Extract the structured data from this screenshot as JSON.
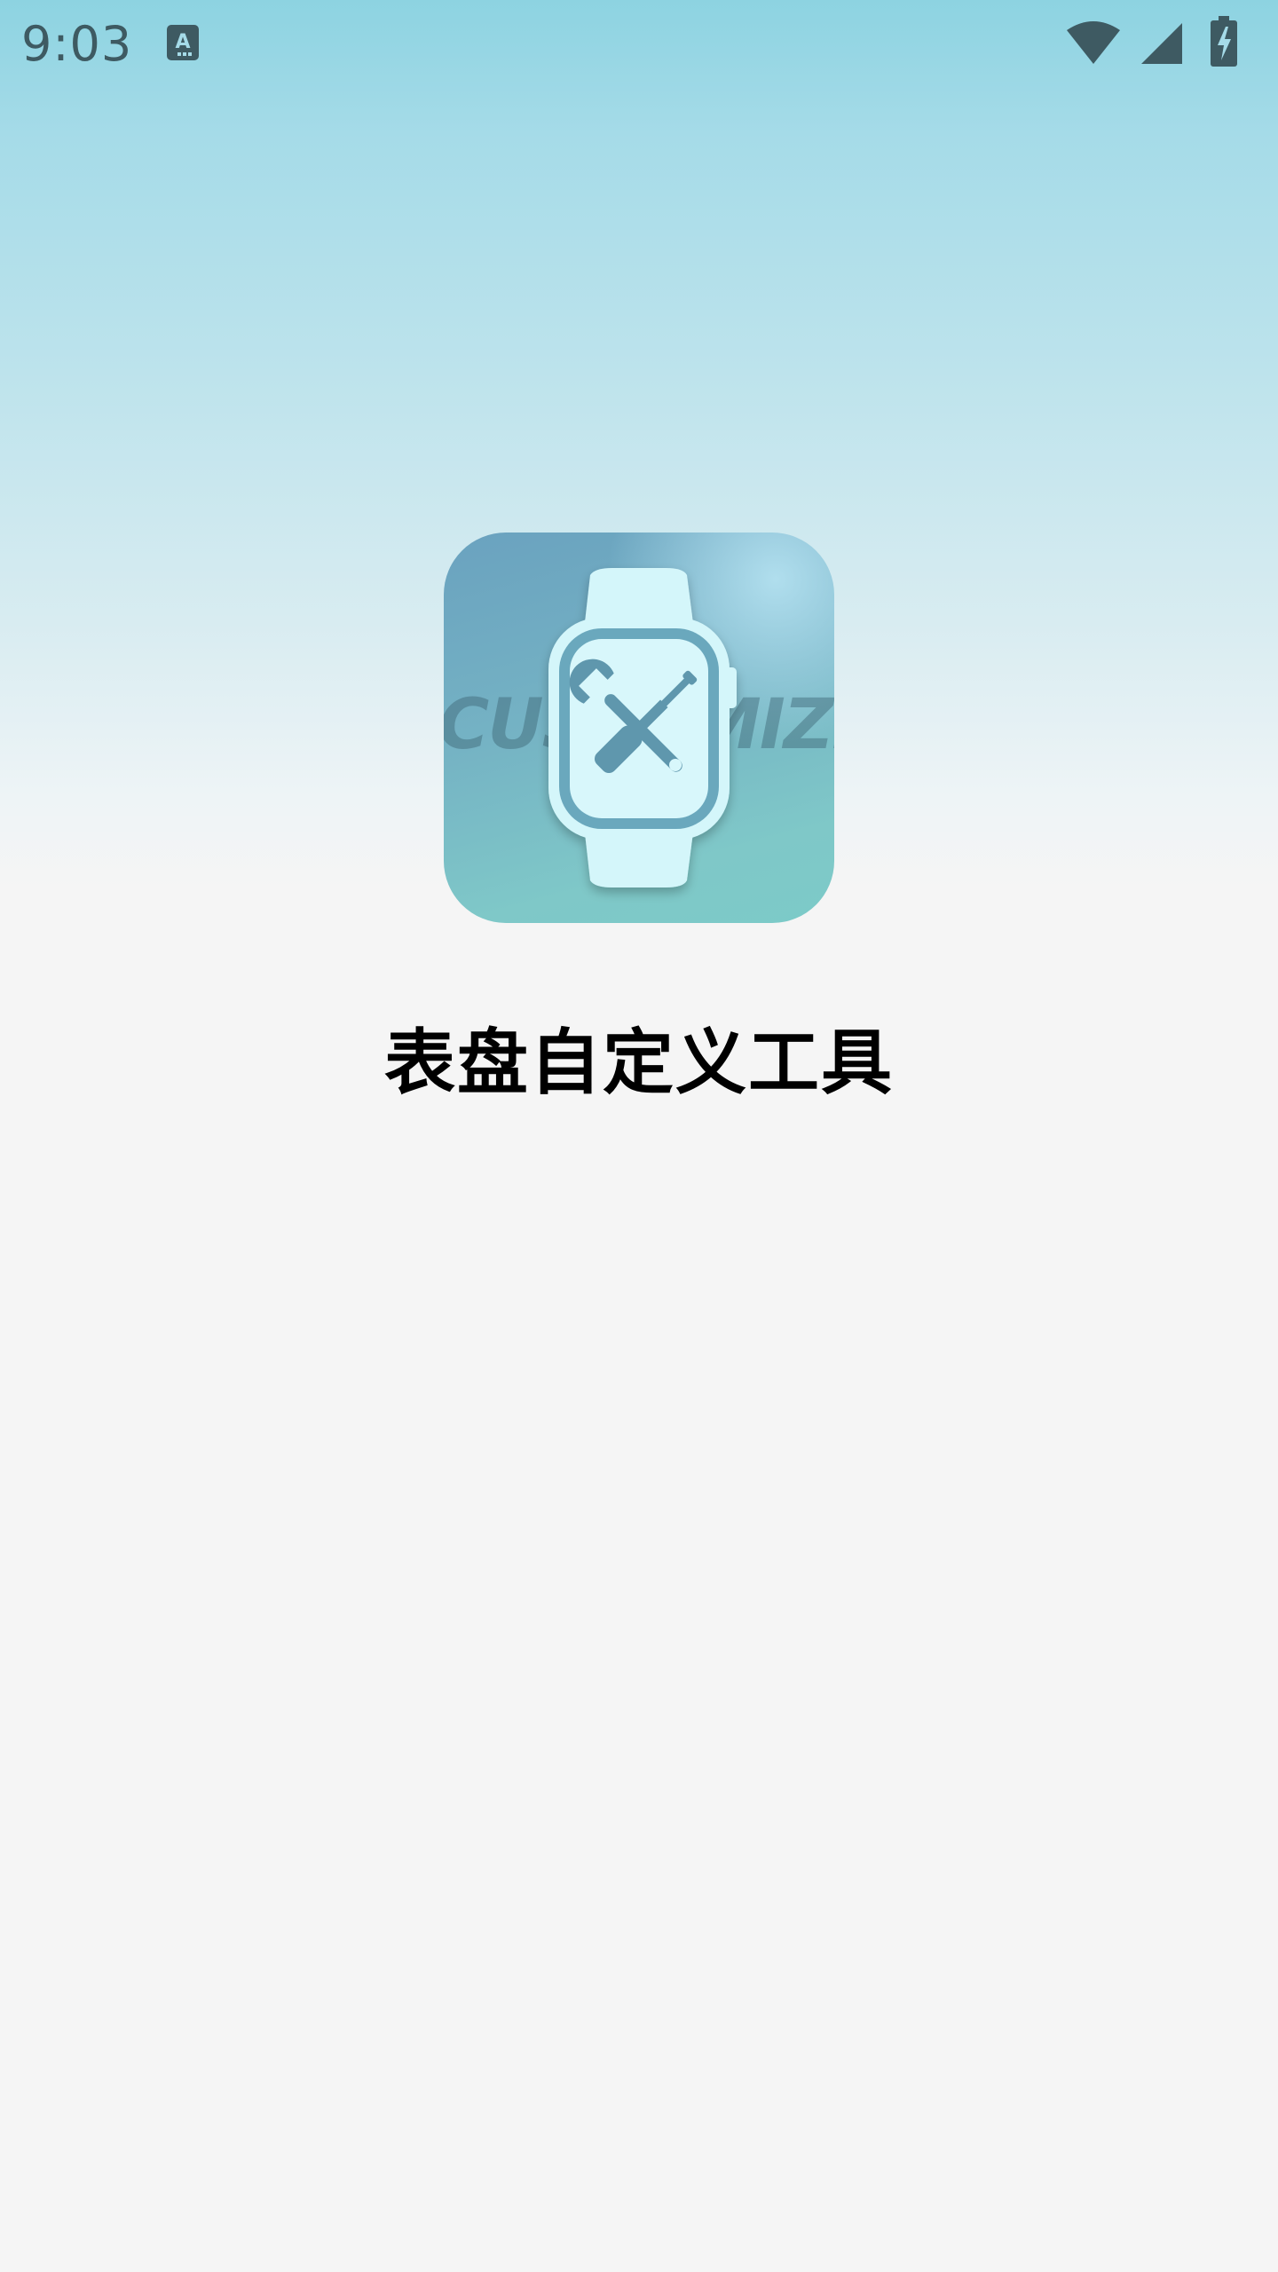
{
  "status_bar": {
    "time": "9:03",
    "notification_icon": "a-text-icon",
    "wifi_icon": "wifi-icon",
    "signal_icon": "cell-signal-icon",
    "battery_icon": "battery-charging-icon"
  },
  "app": {
    "icon_name": "watch-tools-icon",
    "icon_watermark": "CUSTOMIZE",
    "title": "表盘自定义工具"
  },
  "colors": {
    "gradient_top": "#8dd3e1",
    "background": "#f5f5f5",
    "status_icon": "#3e5a62",
    "title_text": "#000000"
  }
}
